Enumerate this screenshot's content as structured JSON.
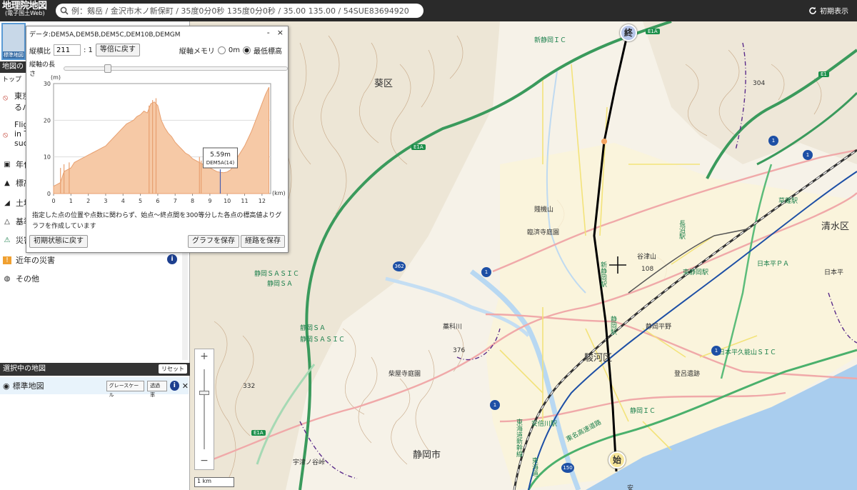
{
  "header": {
    "logo_line1": "地理院地図",
    "logo_line2": "(電子国土Web)",
    "search_placeholder": "例：剱岳 / 金沢市木ノ新保町 / 35度0分0秒 135度0分0秒 / 35.00 135.00 / 54SUE83694920",
    "reset_view_label": "初期表示"
  },
  "left_panel": {
    "thumb_label": "標準地図",
    "menu_head": "地図の",
    "breadcrumb": "トップ",
    "items": [
      {
        "label": "東京…",
        "sub": "るハ…",
        "icon": "no-entry-icon"
      },
      {
        "label": "Flig…",
        "sub": "in T…",
        "sub2": "suc…",
        "icon": "no-entry-icon"
      },
      {
        "label": "年代",
        "icon": "camera-icon"
      },
      {
        "label": "標高",
        "icon": "mountain-icon"
      },
      {
        "label": "土地",
        "icon": "land-icon"
      },
      {
        "label": "基準",
        "icon": "triangle-icon"
      },
      {
        "label": "災害",
        "icon": "disaster-icon"
      },
      {
        "label": "近年の災害",
        "icon": "disaster-recent-icon"
      },
      {
        "label": "その他",
        "icon": "globe-icon"
      }
    ],
    "info_glyph": "i",
    "selected_head": "選択中の地図",
    "reset_label": "リセット",
    "selected_map": "標準地図",
    "grayscale_label": "グレースケール",
    "opacity_label": "透過率",
    "close_glyph": "✕"
  },
  "profile": {
    "title": "データ:DEM5A,DEM5B,DEM5C,DEM10B,DEMGM",
    "minimize": "-",
    "close": "×",
    "ratio_label": "縦横比",
    "ratio_value": "211",
    "ratio_suffix": ": 1",
    "ratio_reset": "等倍に戻す",
    "memory_label": "縦軸メモリ",
    "memory_opt1": "0m",
    "memory_opt2": "最低標高",
    "length_label": "縦軸の長さ",
    "note": "指定した点の位置や点数に関わらず、始点～終点間を300等分した各点の標高値よりグラフを作成しています",
    "btn_initial": "初期状態に戻す",
    "btn_save_graph": "グラフを保存",
    "btn_save_route": "経路を保存"
  },
  "chart_data": {
    "type": "area",
    "ylabel": "(m)",
    "xlabel": "(km)",
    "xlim": [
      0,
      12.5
    ],
    "ylim": [
      0,
      30
    ],
    "xticks": [
      0,
      1,
      2,
      3,
      4,
      5,
      6,
      7,
      8,
      9,
      10,
      11,
      12
    ],
    "yticks": [
      0,
      10,
      20,
      30
    ],
    "x": [
      0,
      0.2,
      0.4,
      0.6,
      0.8,
      1.0,
      1.2,
      1.4,
      1.6,
      1.8,
      2.0,
      2.2,
      2.4,
      2.6,
      2.8,
      3.0,
      3.2,
      3.4,
      3.6,
      3.8,
      4.0,
      4.2,
      4.4,
      4.6,
      4.8,
      5.0,
      5.2,
      5.4,
      5.6,
      5.8,
      6.0,
      6.2,
      6.4,
      6.6,
      6.8,
      7.0,
      7.2,
      7.4,
      7.6,
      7.8,
      8.0,
      8.2,
      8.4,
      8.6,
      8.8,
      9.0,
      9.2,
      9.4,
      9.6,
      9.8,
      10.0,
      10.2,
      10.4,
      10.6,
      10.8,
      11.0,
      11.2,
      11.4,
      11.6,
      11.8,
      12.0,
      12.2,
      12.4
    ],
    "y": [
      2.0,
      2.5,
      3.0,
      6.0,
      6.5,
      7.0,
      8.5,
      9.0,
      9.5,
      10.0,
      10.5,
      11.0,
      11.5,
      12.0,
      12.5,
      13.0,
      14.0,
      15.0,
      16.0,
      17.0,
      18.0,
      19.0,
      19.5,
      20.0,
      21.0,
      21.5,
      22.5,
      22.0,
      24.5,
      25.0,
      24.0,
      20.0,
      18.0,
      16.5,
      15.5,
      14.0,
      13.0,
      12.0,
      11.0,
      10.5,
      9.5,
      9.0,
      8.5,
      8.0,
      7.5,
      7.0,
      6.5,
      6.0,
      5.8,
      5.7,
      5.9,
      6.5,
      8.0,
      10.0,
      11.5,
      13.0,
      15.0,
      17.0,
      19.5,
      22.0,
      24.5,
      27.0,
      29.0
    ],
    "spikes": [
      [
        0.4,
        7.0
      ],
      [
        0.6,
        8.0
      ],
      [
        0.9,
        8.5
      ],
      [
        5.5,
        24.0
      ],
      [
        5.7,
        25.5
      ],
      [
        5.9,
        26.0
      ],
      [
        8.4,
        10.0
      ],
      [
        8.5,
        9.0
      ]
    ],
    "tooltip": {
      "x": 9.6,
      "value": "5.59m",
      "source": "DEM5A(14)"
    },
    "fill": "#f6c9a6",
    "stroke": "#e8a070"
  },
  "map": {
    "labels": {
      "aoi": "葵区",
      "suruga": "駿河区",
      "shimizu": "清水区",
      "shizuoka_city": "静岡市",
      "shinshizuoka_ic": "新静岡ＩＣ",
      "rinzaiji": "臨済寺庭園",
      "shizuhatayama": "賤機山",
      "yatsuyama": "谷津山",
      "higashishizuoka": "東静岡駅",
      "kusanagi": "草薙駅",
      "shizuoka_sasic": "静岡ＳＡＳＩＣ",
      "shizuoka_sa": "静岡ＳＡ",
      "shizuoka_sasic2": "静岡ＳＡＳＩＣ",
      "saishoji": "柴屋寺庭園",
      "toro": "登呂遺跡",
      "shizuoka_ic": "静岡ＩＣ",
      "abekawa": "安倍川駅",
      "shizuoka_heiya": "静岡平野",
      "nihondaira_kunozan": "日本平久能山ＳＩＣ",
      "nihondaira_pa": "日本平ＰＡ",
      "nihondaira": "日本平",
      "utsunoya": "宇津ノ谷峠",
      "tomei": "東名高速道路",
      "tokaido": "東海道新幹線",
      "tokaido2": "東海道",
      "shizuoka_station": "静岡駅",
      "shinshizuoka_station": "新静岡駅",
      "naganuma": "長沼駅",
      "warashinagawa": "藁科川",
      "h376": "376",
      "h332": "332",
      "h304": "304",
      "h108": "108",
      "ann": "安"
    },
    "shields": {
      "e1a": "E1A",
      "e1": "E1"
    },
    "routes": {
      "r1": "1",
      "r362": "362",
      "r150": "150"
    },
    "start_marker": "始",
    "end_marker": "終",
    "scale": "1 km"
  }
}
